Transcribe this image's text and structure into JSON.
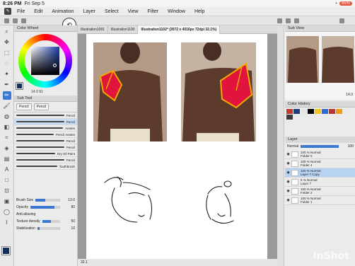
{
  "status": {
    "time": "8:26 PM",
    "date": "Fri Sep 5",
    "battery": "65%",
    "wifi_icon": "wifi-icon"
  },
  "menu": [
    "File",
    "Edit",
    "Animation",
    "Layer",
    "Select",
    "View",
    "Filter",
    "Window",
    "Help"
  ],
  "tabs": [
    {
      "label": "Illustration1091",
      "active": false
    },
    {
      "label": "Illustration1100",
      "active": false
    },
    {
      "label": "Illustration1102* (3072 x 4016px 72dpi 32.1%)",
      "active": true
    }
  ],
  "color_wheel": {
    "title": "Color Wheel",
    "values": "14  0  91"
  },
  "sub_tool": {
    "title": "Sub Tool",
    "tabs": [
      "Pencil",
      "Pencil"
    ],
    "brushes": [
      "Pencil",
      "Pencil",
      "Aestes",
      "Pencil Aestes",
      "Pencil",
      "Pencil",
      "Dry Oil Paint",
      "Pencil",
      "Toothbrush"
    ]
  },
  "tool_property": {
    "brush_size_label": "Brush Size",
    "brush_size_value": "13.0",
    "opacity_label": "Opacity",
    "opacity_value": "80",
    "antialias_label": "Anti-aliasing",
    "texture_label": "Texture density",
    "texture_value": "50",
    "stabilization_label": "Stabilization",
    "stabilization_value": "10"
  },
  "sub_view": {
    "title": "Sub View",
    "zoom": "14.0"
  },
  "color_history": {
    "title": "Color History",
    "colors": [
      "#c0392b",
      "#1f3e7a",
      "#e5e5e5",
      "#000000",
      "#f0c419",
      "#2d6bd3",
      "#b33",
      "#f39c12",
      "#e8e8e8",
      "#3b3b3b"
    ]
  },
  "layer_panel": {
    "title": "Layer",
    "blend": "Normal",
    "opacity": "100",
    "layers": [
      {
        "line1": "100 %  Normal",
        "line2": "Folder 5",
        "selected": false
      },
      {
        "line1": "100 %  Normal",
        "line2": "Folder 4",
        "selected": false
      },
      {
        "line1": "100 %  Normal",
        "line2": "Layer 7 Copy",
        "selected": true
      },
      {
        "line1": "5 %  Normal",
        "line2": "Layer 7",
        "selected": false
      },
      {
        "line1": "100 %  Normal",
        "line2": "Folder 2",
        "selected": false
      },
      {
        "line1": "100 %  Normal",
        "line2": "Folder 1",
        "selected": false
      }
    ]
  },
  "canvas": {
    "zoom": "32.1"
  },
  "watermark": "InShot"
}
